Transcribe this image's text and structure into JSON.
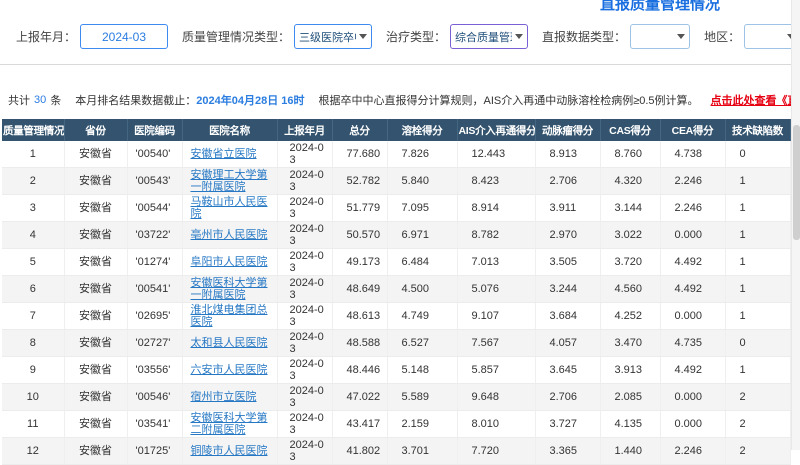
{
  "page": {
    "title": "直报质量管理情况"
  },
  "filters": {
    "report_month": {
      "label": "上报年月：",
      "value": "2024-03"
    },
    "quality_type": {
      "label": "质量管理情况类型：",
      "value": "三级医院卒中中心"
    },
    "treatment_type": {
      "label": "治疗类型：",
      "value": "综合质量管理情况"
    },
    "report_data_type": {
      "label": "直报数据类型：",
      "value": ""
    },
    "region": {
      "label": "地区：",
      "value": ""
    },
    "province_label": "省份"
  },
  "summary": {
    "total_prefix": "共计",
    "total_count": "30",
    "total_suffix": "条",
    "deadline_label": "本月排名结果数据截止：",
    "deadline_value": "2024年04月28日 16时",
    "rule_note": "根据卒中中心直报得分计算规则，AIS介入再通中动脉溶栓检病例≥0.5例计算。",
    "rule_link": "点击此处查看《直报质量管理情况计分规则》"
  },
  "table": {
    "headers": [
      "质量管理情况",
      "省份",
      "医院编码",
      "医院名称",
      "上报年月",
      "总分",
      "溶栓得分",
      "AIS介入再通得分",
      "动脉瘤得分",
      "CAS得分",
      "CEA得分",
      "技术缺陷数"
    ],
    "rows": [
      [
        "1",
        "安徽省",
        "'00540'",
        "安徽省立医院",
        "2024-03",
        "77.680",
        "7.826",
        "12.443",
        "8.913",
        "8.760",
        "4.738",
        "0"
      ],
      [
        "2",
        "安徽省",
        "'00543'",
        "安徽理工大学第一附属医院",
        "2024-03",
        "52.782",
        "5.840",
        "8.423",
        "2.706",
        "4.320",
        "2.246",
        "1"
      ],
      [
        "3",
        "安徽省",
        "'00544'",
        "马鞍山市人民医院",
        "2024-03",
        "51.779",
        "7.095",
        "8.914",
        "3.911",
        "3.144",
        "2.246",
        "1"
      ],
      [
        "4",
        "安徽省",
        "'03722'",
        "亳州市人民医院",
        "2024-03",
        "50.570",
        "6.971",
        "8.782",
        "2.970",
        "3.022",
        "0.000",
        "1"
      ],
      [
        "5",
        "安徽省",
        "'01274'",
        "阜阳市人民医院",
        "2024-03",
        "49.173",
        "6.484",
        "7.013",
        "3.505",
        "3.720",
        "4.492",
        "1"
      ],
      [
        "6",
        "安徽省",
        "'00541'",
        "安徽医科大学第一附属医院",
        "2024-03",
        "48.649",
        "4.500",
        "5.076",
        "3.244",
        "4.560",
        "4.492",
        "1"
      ],
      [
        "7",
        "安徽省",
        "'02695'",
        "淮北煤电集团总医院",
        "2024-03",
        "48.613",
        "4.749",
        "9.107",
        "3.684",
        "4.252",
        "0.000",
        "1"
      ],
      [
        "8",
        "安徽省",
        "'02727'",
        "太和县人民医院",
        "2024-03",
        "48.588",
        "6.527",
        "7.567",
        "4.057",
        "3.470",
        "4.735",
        "0"
      ],
      [
        "9",
        "安徽省",
        "'03556'",
        "六安市人民医院",
        "2024-03",
        "48.446",
        "5.148",
        "5.857",
        "3.645",
        "3.913",
        "4.492",
        "1"
      ],
      [
        "10",
        "安徽省",
        "'00546'",
        "宿州市立医院",
        "2024-03",
        "47.022",
        "5.589",
        "9.648",
        "2.706",
        "2.085",
        "0.000",
        "2"
      ],
      [
        "11",
        "安徽省",
        "'03541'",
        "安徽医科大学第二附属医院",
        "2024-03",
        "43.417",
        "2.159",
        "8.010",
        "3.727",
        "4.135",
        "0.000",
        "2"
      ],
      [
        "12",
        "安徽省",
        "'01725'",
        "铜陵市人民医院",
        "2024-03",
        "41.802",
        "3.701",
        "7.720",
        "3.365",
        "1.440",
        "2.246",
        "2"
      ]
    ]
  }
}
